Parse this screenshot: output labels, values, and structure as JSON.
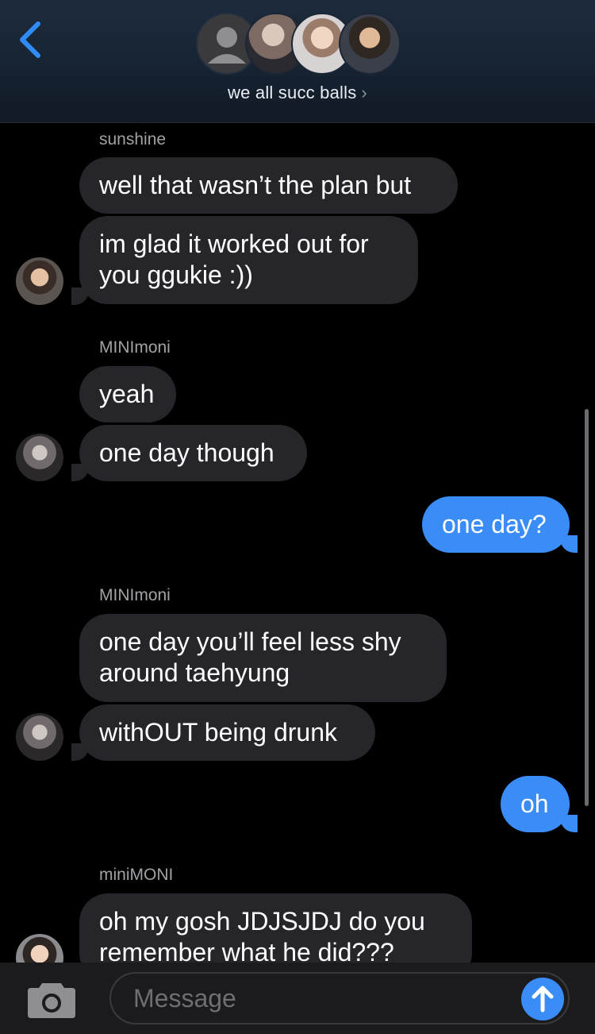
{
  "header": {
    "back_icon": "chevron-left-icon",
    "group_name": "we all succ balls",
    "chevron": "›"
  },
  "messages": [
    {
      "sender": "sunshine",
      "lines": [
        "well that wasn’t the plan but",
        "im glad it worked out for\nyou ggukie :))"
      ]
    },
    {
      "sender": "MINImoni",
      "lines": [
        "yeah",
        "one day though"
      ]
    },
    {
      "outgoing": "one day?"
    },
    {
      "sender": "MINImoni",
      "lines": [
        "one day you’ll feel less shy\naround taehyung",
        "withOUT being drunk"
      ]
    },
    {
      "outgoing": "oh"
    },
    {
      "sender": "miniMONI",
      "lines": [
        "oh my gosh JDJSJDJ do you\nremember what he did???"
      ]
    }
  ],
  "composer": {
    "placeholder": "Message",
    "camera_icon": "camera-icon",
    "send_icon": "arrow-up-icon"
  },
  "colors": {
    "incoming_bubble": "#26262a",
    "outgoing_bubble": "#3a8cf7",
    "background": "#000000"
  }
}
